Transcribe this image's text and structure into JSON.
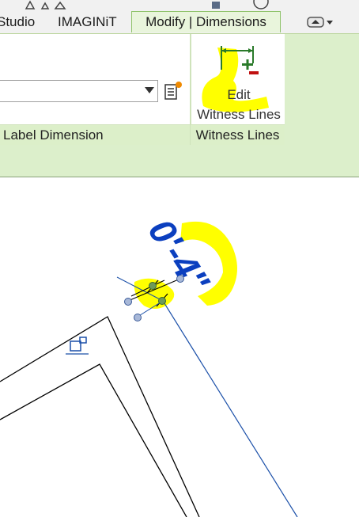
{
  "ribbon": {
    "tabs": [
      {
        "label": "Studio"
      },
      {
        "label": "IMAGINiT"
      },
      {
        "label": "Modify | Dimensions"
      }
    ],
    "panels": [
      {
        "label": "Label Dimension"
      },
      {
        "label": "Witness Lines"
      }
    ],
    "edit_witness_lines": {
      "line1": "Edit",
      "line2": "Witness Lines"
    },
    "icons": [
      "properties-icon",
      "edit-witness-lines-icon",
      "ribbon-options-icon"
    ],
    "colors": {
      "active_tab_border": "#8fc36a",
      "panel_bar": "#dcefcb",
      "highlight": "#ffff00"
    }
  },
  "canvas": {
    "dimension_value": "0'-4\"",
    "dimension_color": "#0b3fbf",
    "lock_icon": "lock-icon"
  }
}
